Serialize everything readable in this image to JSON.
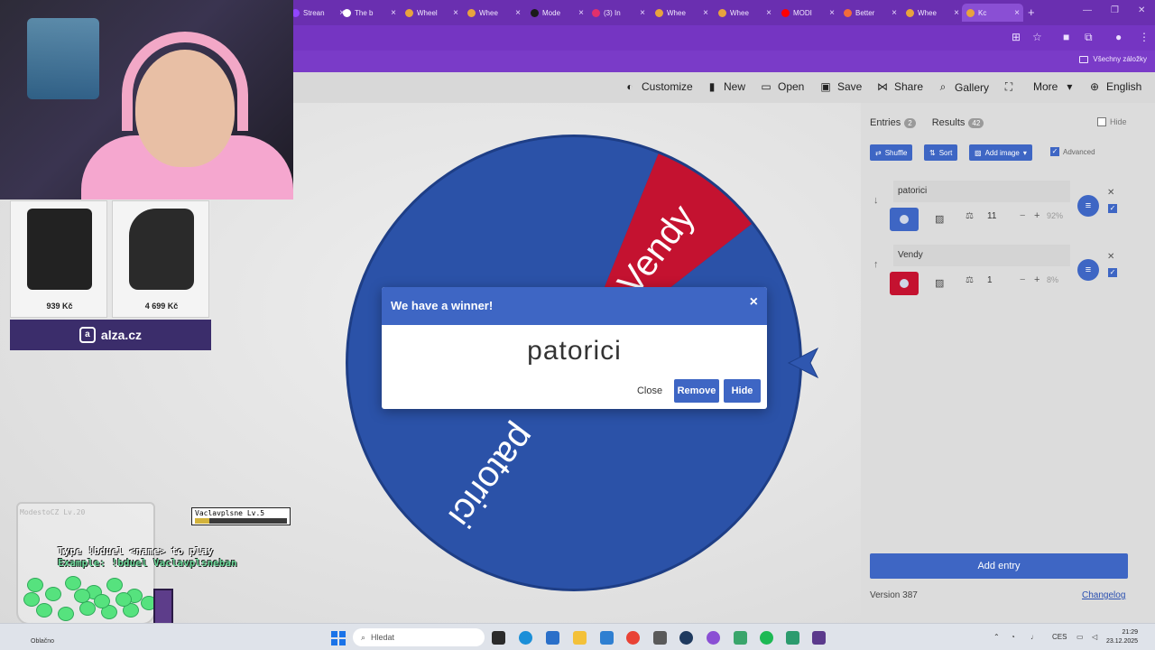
{
  "browser": {
    "tabs": [
      {
        "label": "Strean",
        "color": "#9146ff"
      },
      {
        "label": "The b",
        "color": "#ffffff"
      },
      {
        "label": "Wheel",
        "color": "#e8a33d"
      },
      {
        "label": "Whee",
        "color": "#e8a33d"
      },
      {
        "label": "Mode",
        "color": "#1b1b1b"
      },
      {
        "label": "(3) In",
        "color": "#e1306c"
      },
      {
        "label": "Whee",
        "color": "#e8a33d"
      },
      {
        "label": "Whee",
        "color": "#e8a33d"
      },
      {
        "label": "MODI",
        "color": "#ff0000"
      },
      {
        "label": "Better",
        "color": "#f26b3a"
      },
      {
        "label": "Whee",
        "color": "#e8a33d"
      },
      {
        "label": "Kc",
        "color": "#e8a33d"
      }
    ],
    "bookmarks_all_label": "Všechny záložky"
  },
  "nav": {
    "customize": "Customize",
    "new": "New",
    "open": "Open",
    "save": "Save",
    "share": "Share",
    "gallery": "Gallery",
    "more": "More",
    "language": "English"
  },
  "wheel": {
    "slices": [
      {
        "label": "patorici",
        "color": "#2b52a8",
        "weight": 11
      },
      {
        "label": "Vendy",
        "color": "#c41230",
        "weight": 1
      }
    ]
  },
  "dialog": {
    "title": "We have a winner!",
    "winner": "patorici",
    "close_label": "Close",
    "remove_label": "Remove",
    "hide_label": "Hide"
  },
  "sidebar": {
    "entries_tab": "Entries",
    "entries_count": "2",
    "results_tab": "Results",
    "results_count": "42",
    "hide_label": "Hide",
    "shuffle_label": "Shuffle",
    "sort_label": "Sort",
    "add_image_label": "Add image",
    "advanced_label": "Advanced",
    "entries": [
      {
        "name": "patorici",
        "weight": "11",
        "percent": "92%",
        "color": "#3e66c4",
        "arrow": "↓"
      },
      {
        "name": "Vendy",
        "weight": "1",
        "percent": "8%",
        "color": "#c41230",
        "arrow": "↑"
      }
    ],
    "add_entry_label": "Add entry",
    "version": "Version 387",
    "changelog": "Changelog"
  },
  "overlay": {
    "ad_prices": [
      "939 Kč",
      "4 699 Kč"
    ],
    "ad_brand": "alza.cz",
    "jar_name": "ModestoCZ",
    "jar_level": "Lv.20",
    "duel_line1": "Type !bduel <name> to play",
    "duel_line2": "Example: !bduel Vaclavplsneban",
    "player_name": "Vaclavplsne",
    "player_level": "Lv.5",
    "player_hp_fraction": 0.16
  },
  "taskbar": {
    "weather": "Oblačno",
    "search_placeholder": "Hledat",
    "language": "CES",
    "time": "21:29",
    "date": "23.12.2025"
  }
}
